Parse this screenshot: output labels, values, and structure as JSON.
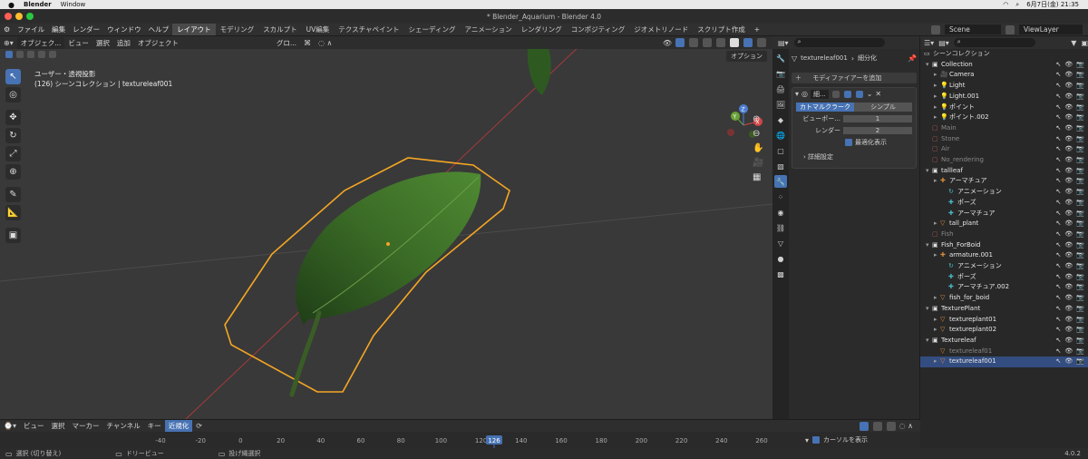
{
  "mac_menu": {
    "app": "Blender",
    "items": [
      "Window"
    ],
    "clock": "6月7日(金) 21:35"
  },
  "window": {
    "title": "* Blender_Aquarium - Blender 4.0"
  },
  "app_menu": [
    "ファイル",
    "編集",
    "レンダー",
    "ウィンドウ",
    "ヘルプ"
  ],
  "workspaces": [
    "レイアウト",
    "モデリング",
    "スカルプト",
    "UV編集",
    "テクスチャペイント",
    "シェーディング",
    "アニメーション",
    "レンダリング",
    "コンポジティング",
    "ジオメトリノード",
    "スクリプト作成"
  ],
  "scene": {
    "label": "Scene",
    "view_layer": "ViewLayer"
  },
  "viewport": {
    "mode": "オブジェク...",
    "menus": [
      "ビュー",
      "選択",
      "追加",
      "オブジェクト"
    ],
    "transform": "グロ...",
    "options": "オプション",
    "overlay_line1": "ユーザー・透視投影",
    "overlay_line2": "(126) シーンコレクション | textureleaf001",
    "gizmo": {
      "x": "X",
      "y": "Y",
      "z": "Z"
    }
  },
  "properties": {
    "object": "textureleaf001",
    "tab": "細分化",
    "add_modifier": "モディファイアーを追加",
    "modifier_name": "細...",
    "toggle_a": "カトマルクラーク",
    "toggle_b": "シンプル",
    "viewport_label": "ビューポー...",
    "viewport_value": "1",
    "render_label": "レンダー",
    "render_value": "2",
    "optimal": "最適化表示",
    "advanced": "詳細設定"
  },
  "outliner": {
    "root": "シーンコレクション",
    "rows": [
      {
        "label": "Collection",
        "indent": 1,
        "type": "coll"
      },
      {
        "label": "Camera",
        "indent": 2,
        "type": "cam"
      },
      {
        "label": "Light",
        "indent": 2,
        "type": "light"
      },
      {
        "label": "Light.001",
        "indent": 2,
        "type": "light"
      },
      {
        "label": "ポイント",
        "indent": 2,
        "type": "light"
      },
      {
        "label": "ポイント.002",
        "indent": 2,
        "type": "light"
      },
      {
        "label": "Main",
        "indent": 1,
        "type": "collx"
      },
      {
        "label": "Stone",
        "indent": 1,
        "type": "collx"
      },
      {
        "label": "Air",
        "indent": 1,
        "type": "collx"
      },
      {
        "label": "No_rendering",
        "indent": 1,
        "type": "collx"
      },
      {
        "label": "tallleaf",
        "indent": 1,
        "type": "coll"
      },
      {
        "label": "アーマチュア",
        "indent": 2,
        "type": "arm"
      },
      {
        "label": "アニメーション",
        "indent": 3,
        "type": "anim"
      },
      {
        "label": "ポーズ",
        "indent": 3,
        "type": "pose"
      },
      {
        "label": "アーマチュア",
        "indent": 3,
        "type": "armd"
      },
      {
        "label": "tall_plant",
        "indent": 2,
        "type": "mesh"
      },
      {
        "label": "Fish",
        "indent": 1,
        "type": "collx"
      },
      {
        "label": "Fish_ForBoid",
        "indent": 1,
        "type": "coll"
      },
      {
        "label": "armature.001",
        "indent": 2,
        "type": "arm"
      },
      {
        "label": "アニメーション",
        "indent": 3,
        "type": "anim"
      },
      {
        "label": "ポーズ",
        "indent": 3,
        "type": "pose"
      },
      {
        "label": "アーマチュア.002",
        "indent": 3,
        "type": "armd"
      },
      {
        "label": "fish_for_boid",
        "indent": 2,
        "type": "mesh"
      },
      {
        "label": "TexturePlant",
        "indent": 1,
        "type": "coll"
      },
      {
        "label": "textureplant01",
        "indent": 2,
        "type": "mesh"
      },
      {
        "label": "textureplant02",
        "indent": 2,
        "type": "mesh"
      },
      {
        "label": "Textureleaf",
        "indent": 1,
        "type": "coll"
      },
      {
        "label": "textureleaf01",
        "indent": 2,
        "type": "meshd"
      },
      {
        "label": "textureleaf001",
        "indent": 2,
        "type": "mesh",
        "selected": true
      }
    ]
  },
  "timeline": {
    "menus": [
      "ビュー",
      "選択",
      "マーカー",
      "チャンネル",
      "キー"
    ],
    "normalize": "近規化",
    "current_frame": "126",
    "ticks": [
      "-40",
      "-20",
      "0",
      "20",
      "40",
      "60",
      "80",
      "100",
      "120",
      "140",
      "160",
      "180",
      "200",
      "220",
      "240",
      "260"
    ],
    "cursor_label": "カーソルを表示"
  },
  "status": {
    "select": "選択 (切り替え)",
    "pan": "ドリービュー",
    "lasso": "投げ縄選択",
    "version": "4.0.2"
  },
  "colors": {
    "accent": "#4772b3",
    "select_outline": "#f5a623",
    "header": "#303030"
  }
}
